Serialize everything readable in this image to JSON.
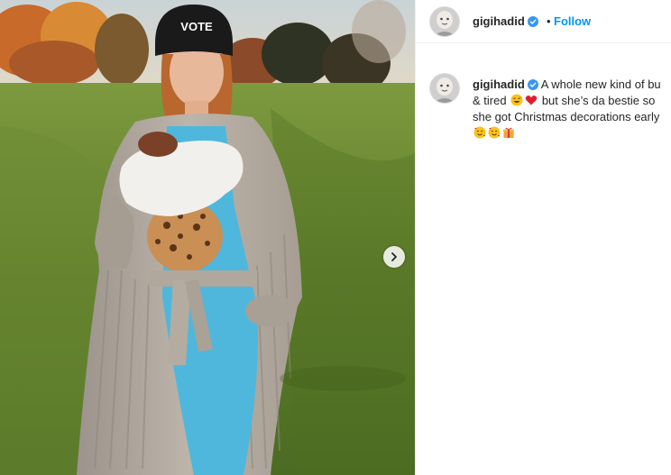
{
  "post": {
    "username": "gigihadid",
    "verified": true,
    "follow_label": "Follow",
    "separator": "•",
    "photo_alt": "Woman in knit cardigan holding a baby in a field",
    "caption": {
      "line1": "A whole new kind of bu",
      "line2a": "& tired",
      "line2b": "but she’s da bestie so",
      "line3": "she got Christmas decorations early"
    },
    "emojis": {
      "line2": [
        "grinning-sweat",
        "red-heart"
      ],
      "line4": [
        "smiling-hearts",
        "smiling-hearts",
        "gift"
      ]
    }
  },
  "icons": {
    "next": "chevron-right-icon",
    "verified": "verified-badge-icon"
  },
  "colors": {
    "link_blue": "#0095f6",
    "text": "#262626",
    "verified": "#3897f0"
  }
}
